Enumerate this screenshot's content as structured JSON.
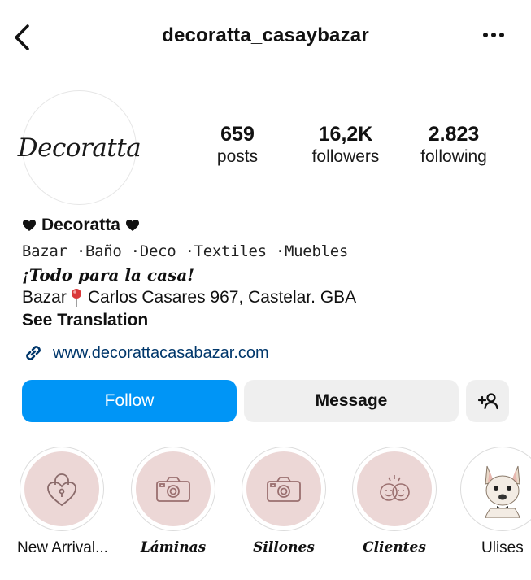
{
  "header": {
    "username": "decoratta_casaybazar",
    "back_icon": "chevron-left-icon",
    "more_icon": "more-horizontal-icon"
  },
  "profile": {
    "avatar_text": "Decoratta",
    "stats": [
      {
        "value": "659",
        "label": "posts"
      },
      {
        "value": "16,2K",
        "label": "followers"
      },
      {
        "value": "2.823",
        "label": "following"
      }
    ]
  },
  "bio": {
    "name": "Decoratta",
    "line1": "Bazar ·Baño ·Deco ·Textiles ·Muebles",
    "line2": "¡Todo para la casa!",
    "line3_prefix": "Bazar",
    "line3_address": "Carlos Casares 967, Castelar. GBA",
    "see_translation": "See Translation",
    "link": "www.decorattacasabazar.com"
  },
  "actions": {
    "follow": "Follow",
    "message": "Message",
    "add_icon": "add-person-icon"
  },
  "highlights": [
    {
      "label": "New Arrival...",
      "icon": "heart-lock-icon"
    },
    {
      "label": "Láminas",
      "icon": "camera-icon"
    },
    {
      "label": "Sillones",
      "icon": "camera-icon"
    },
    {
      "label": "Clientes",
      "icon": "smiley-faces-icon"
    },
    {
      "label": "Ulises",
      "icon": "dog-photo-icon"
    }
  ],
  "colors": {
    "follow_button": "#0095f6",
    "link": "#00376b",
    "highlight_bg": "#ecd7d6"
  }
}
